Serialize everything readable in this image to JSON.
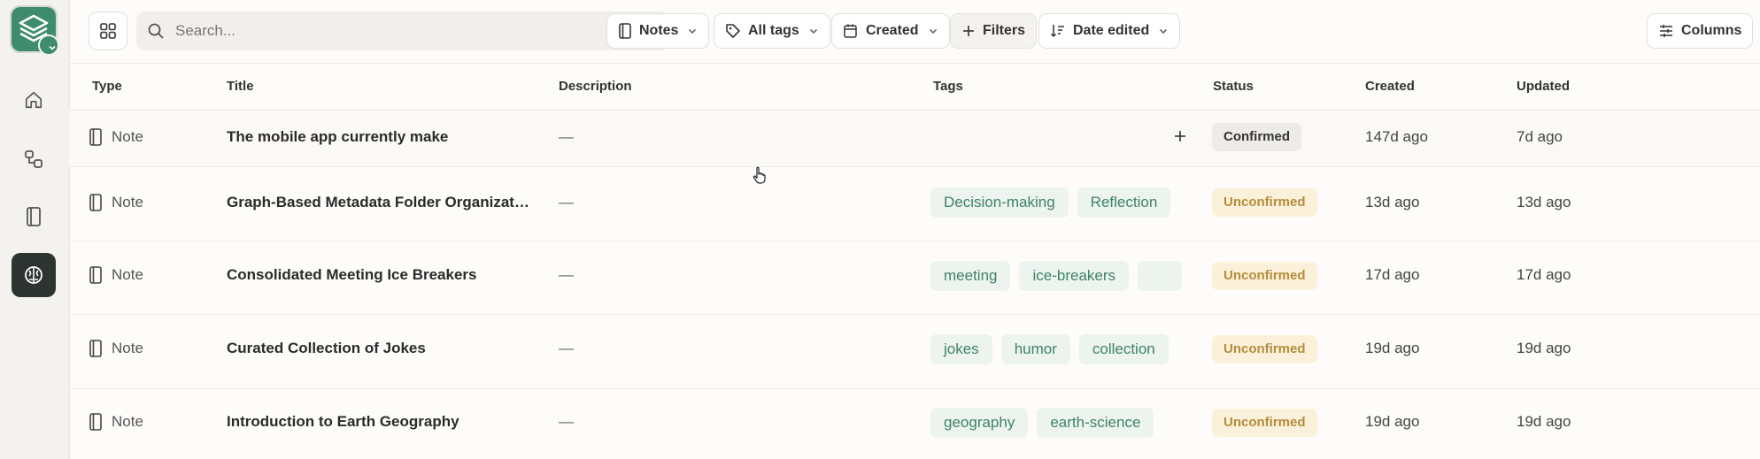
{
  "search": {
    "placeholder": "Search..."
  },
  "toolbar": {
    "notes_label": "Notes",
    "tags_label": "All tags",
    "created_label": "Created",
    "filters_label": "Filters",
    "sort_label": "Date edited",
    "columns_label": "Columns"
  },
  "columns": {
    "type": "Type",
    "title": "Title",
    "description": "Description",
    "tags": "Tags",
    "status": "Status",
    "created": "Created",
    "updated": "Updated"
  },
  "rows": [
    {
      "type": "Note",
      "title": "The mobile app currently make",
      "description": "—",
      "tags": [],
      "status": "Confirmed",
      "created": "147d ago",
      "updated": "7d ago"
    },
    {
      "type": "Note",
      "title": "Graph-Based Metadata Folder Organization",
      "description": "—",
      "tags": [
        "Decision-making",
        "Reflection"
      ],
      "status": "Unconfirmed",
      "created": "13d ago",
      "updated": "13d ago"
    },
    {
      "type": "Note",
      "title": "Consolidated Meeting Ice Breakers",
      "description": "—",
      "tags": [
        "meeting",
        "ice-breakers",
        ""
      ],
      "status": "Unconfirmed",
      "created": "17d ago",
      "updated": "17d ago"
    },
    {
      "type": "Note",
      "title": "Curated Collection of Jokes",
      "description": "—",
      "tags": [
        "jokes",
        "humor",
        "collection"
      ],
      "status": "Unconfirmed",
      "created": "19d ago",
      "updated": "19d ago"
    },
    {
      "type": "Note",
      "title": "Introduction to Earth Geography",
      "description": "—",
      "tags": [
        "geography",
        "earth-science"
      ],
      "status": "Unconfirmed",
      "created": "19d ago",
      "updated": "19d ago"
    }
  ],
  "icons": {
    "logo": "layers-logo-icon",
    "home": "home-icon",
    "graph": "graph-nodes-icon",
    "notebook": "notebook-icon",
    "brain": "brain-icon"
  },
  "colors": {
    "brand": "#3f8b6d",
    "tag_text": "#3d8466",
    "tag_bg": "#edf3ef",
    "unconfirmed_bg": "#fbf1da",
    "unconfirmed_text": "#b48c3b"
  }
}
